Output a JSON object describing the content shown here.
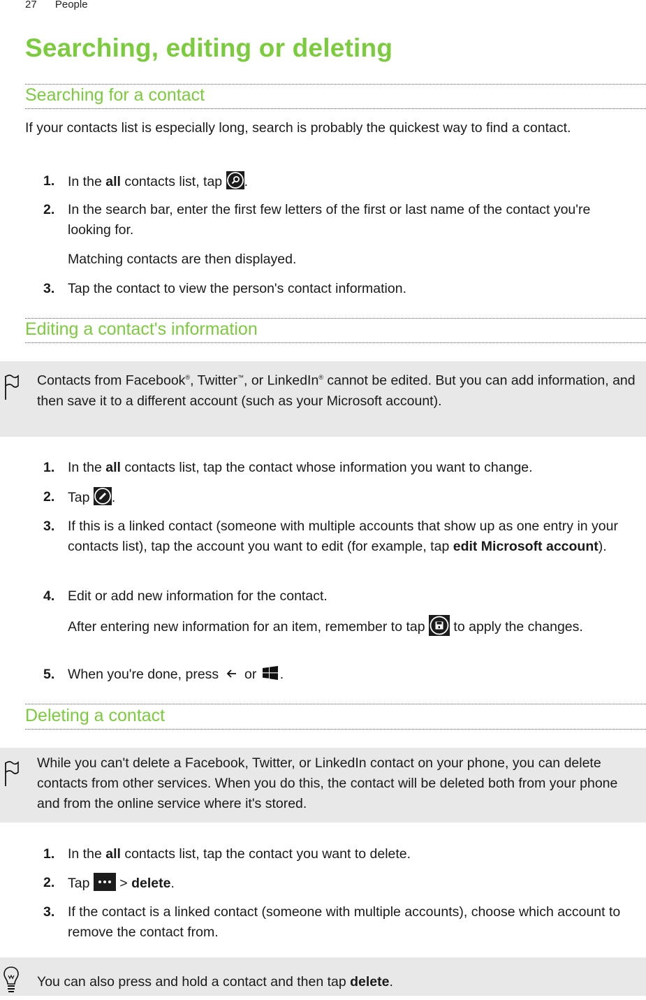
{
  "header": {
    "page_number": "27",
    "section": "People"
  },
  "title": "Searching, editing or deleting",
  "sections": {
    "search": {
      "heading": "Searching for a contact",
      "intro": "If your contacts list is especially long, search is probably the quickest way to find a contact.",
      "steps": [
        {
          "num": "1.",
          "pre": "In the ",
          "bold": "all",
          "post": " contacts list, tap ",
          "icon": "search-icon",
          "end": "."
        },
        {
          "num": "2.",
          "text": "In the search bar, enter the first few letters of the first or last name of the contact you're looking for."
        },
        {
          "num": "3.",
          "text": "Tap the contact to view the person's contact information."
        }
      ],
      "step2_result": "Matching contacts are then displayed."
    },
    "edit": {
      "heading": "Editing a contact's information",
      "note": {
        "icon": "flag-icon",
        "p1": "Contacts from Facebook",
        "p2": ", Twitter",
        "p3": ", or LinkedIn",
        "p4": " cannot be edited. But you can add information, and then save it to a different account (such as your Microsoft account).",
        "reg": "®",
        "tm": "™"
      },
      "steps": [
        {
          "num": "1.",
          "pre": "In the ",
          "bold": "all",
          "post": " contacts list, tap the contact whose information you want to change."
        },
        {
          "num": "2.",
          "pre": "Tap ",
          "icon": "edit-icon",
          "end": "."
        },
        {
          "num": "3.",
          "pre": "If this is a linked contact (someone with multiple accounts that show up as one entry in your contacts list), tap the account you want to edit (for example, tap ",
          "bold": "edit Microsoft account",
          "end": ")."
        },
        {
          "num": "4.",
          "text": "Edit or add new information for the contact."
        },
        {
          "num": "5.",
          "pre": "When you're done, press ",
          "icon1": "back-icon",
          "mid": " or ",
          "icon2": "windows-start-icon",
          "end": "."
        }
      ],
      "step4_result_pre": "After entering new information for an item, remember to tap ",
      "step4_result_icon": "save-icon",
      "step4_result_post": " to apply the changes."
    },
    "delete": {
      "heading": "Deleting a contact",
      "note": {
        "icon": "flag-icon",
        "text": "While you can't delete a Facebook, Twitter, or LinkedIn contact on your phone, you can delete contacts from other services. When you do this, the contact will be deleted both from your phone and from the online service where it's stored."
      },
      "steps": [
        {
          "num": "1.",
          "pre": "In the ",
          "bold": "all",
          "post": " contacts list, tap the contact you want to delete."
        },
        {
          "num": "2.",
          "pre": "Tap ",
          "icon": "more-icon",
          "mid": " > ",
          "bold": "delete",
          "end": "."
        },
        {
          "num": "3.",
          "text": "If the contact is a linked contact (someone with multiple accounts), choose which account to remove the contact from."
        }
      ],
      "tip": {
        "icon": "lightbulb-icon",
        "pre": "You can also press and hold a contact and then tap ",
        "bold": "delete",
        "end": "."
      }
    }
  },
  "colors": {
    "heading_green": "#7acc3c",
    "note_bg": "#e8e8e8",
    "icon_bg": "#1c1c1c"
  }
}
